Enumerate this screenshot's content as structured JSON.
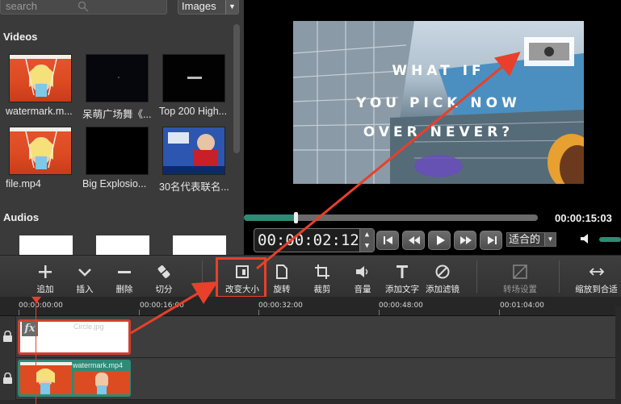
{
  "library": {
    "search_placeholder": "search",
    "filter_value": "Images",
    "videos_title": "Videos",
    "audios_title": "Audios",
    "videos": [
      {
        "label": "watermark.m..."
      },
      {
        "label": "呆萌广场舞《..."
      },
      {
        "label": "Top 200 High..."
      },
      {
        "label": "file.mp4"
      },
      {
        "label": "Big Explosio..."
      },
      {
        "label": "30名代表联名..."
      }
    ]
  },
  "preview": {
    "overlay_lines": [
      "WHAT IF",
      "YOU PICK NOW",
      "OVER NEVER?"
    ],
    "total_time": "00:00:15:03",
    "current_time": "00:00:02:12",
    "fit_option": "适合的",
    "progress": 0.18
  },
  "toolbar": {
    "add": "追加",
    "insert": "插入",
    "delete": "删除",
    "split": "切分",
    "resize": "改变大小",
    "rotate": "旋转",
    "crop": "裁剪",
    "volume": "音量",
    "add_text": "添加文字",
    "add_filter": "添加滤镜",
    "transition": "转场设置",
    "zoom_fit": "缩放到合适"
  },
  "timeline": {
    "ticks": [
      "00:00:00:00",
      "00:00:16:00",
      "00:00:32:00",
      "00:00:48:00",
      "00:01:04:00"
    ],
    "clip_png_name": "Circle.jpg",
    "clip_mp4_name": "watermark.mp4",
    "clip_png_badge": "fx"
  },
  "colors": {
    "accent_teal": "#2e8b74",
    "highlight_red": "#e8402a"
  }
}
